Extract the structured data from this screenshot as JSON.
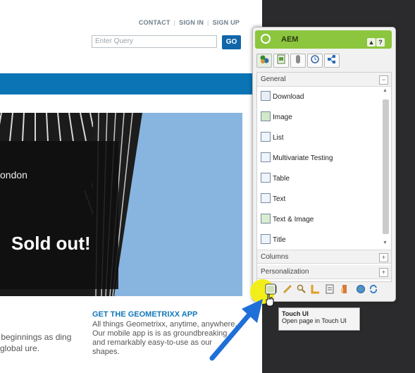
{
  "website": {
    "nav": [
      "CONTACT",
      "SIGN IN",
      "SIGN UP"
    ],
    "search_placeholder": "Enter Query",
    "go_label": "GO",
    "hero_city": "ondon",
    "hero_tagline": "Sold out!",
    "app_title": "GET THE GEOMETRIXX APP",
    "app_text": "All things Geometrixx, anytime, anywhere. Our mobile app is is as groundbreaking and remarkably easy-to-use as our shapes.",
    "left_text": "r beginnings as ding global ure."
  },
  "sidekick": {
    "title": "AEM",
    "header_buttons": [
      "▲",
      "?"
    ],
    "tabs": [
      "components-tab",
      "page-tab",
      "information-tab",
      "versioning-tab",
      "workflow-tab"
    ],
    "groups": [
      {
        "label": "General",
        "state": "−"
      },
      {
        "label": "Columns",
        "state": "+"
      },
      {
        "label": "Personalization",
        "state": "+"
      }
    ],
    "components": [
      "Download",
      "Image",
      "List",
      "Multivariate Testing",
      "Table",
      "Text",
      "Text & Image",
      "Title"
    ],
    "tools": [
      "touch-ui-icon",
      "edit-icon",
      "search-icon",
      "ruler-icon",
      "document-icon",
      "properties-icon",
      "globe-icon",
      "refresh-icon"
    ]
  },
  "tooltip": {
    "title": "Touch UI",
    "text": "Open page in Touch UI"
  },
  "colors": {
    "sidekick_header": "#8cc63e",
    "accent_blue": "#0a74b5",
    "highlight": "#f2ee1a"
  }
}
